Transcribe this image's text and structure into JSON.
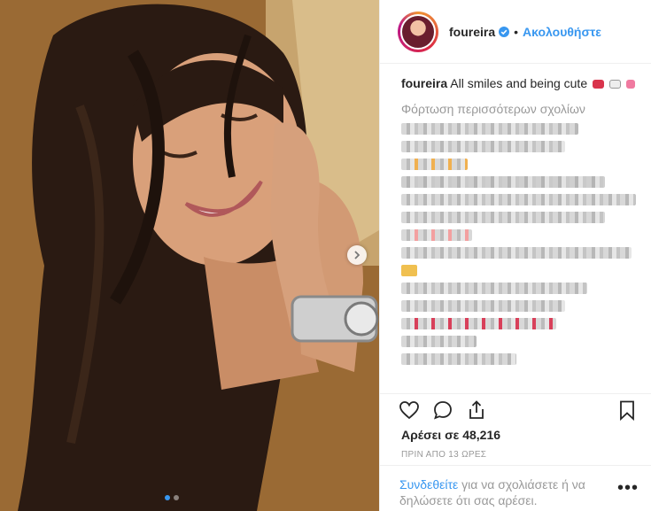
{
  "post": {
    "username": "foureira",
    "follow_label": "Ακολουθήστε",
    "caption_user": "foureira",
    "caption_text": "All smiles and being cute",
    "load_more": "Φόρτωση περισσότερων σχολίων",
    "likes": "Αρέσει σε 48,216",
    "timestamp": "ΠΡΙΝ ΑΠΟ 13 ΩΡΕΣ",
    "login_link": "Συνδεθείτε",
    "login_text": " για να σχολιάσετε ή να δηλώσετε ότι σας αρέσει.",
    "more_label": "•••"
  },
  "icons": {
    "verified": "verified-badge-icon",
    "like": "heart-icon",
    "comment": "comment-icon",
    "share": "share-icon",
    "save": "bookmark-icon",
    "next": "chevron-right-icon"
  },
  "colors": {
    "link": "#3897f0",
    "muted": "#999999",
    "text": "#262626"
  },
  "carousel": {
    "count": 2,
    "active": 1
  }
}
